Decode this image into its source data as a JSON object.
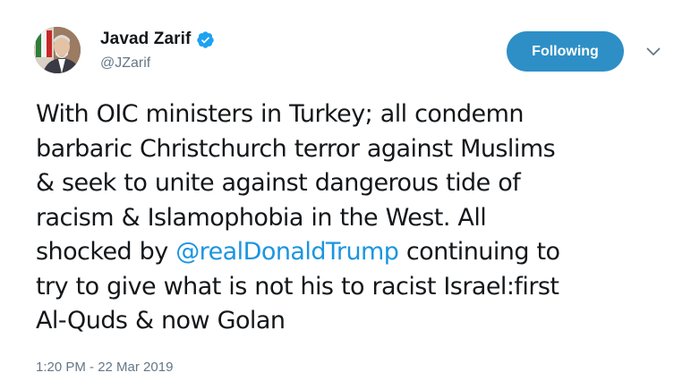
{
  "author": {
    "display_name": "Javad Zarif",
    "handle": "@JZarif",
    "verified": true
  },
  "follow_button": {
    "label": "Following"
  },
  "tweet": {
    "lines": [
      {
        "text": "With OIC ministers in Turkey; all condemn"
      },
      {
        "text": "barbaric Christchurch terror against Muslims"
      },
      {
        "text": "& seek to unite against dangerous tide of"
      },
      {
        "text": "racism & Islamophobia in the West. All"
      },
      {
        "before": "shocked by ",
        "mention": "@realDonaldTrump",
        "after": " continuing to"
      },
      {
        "text": "try to give what is not his to racist Israel:first"
      },
      {
        "text": "Al-Quds & now Golan"
      }
    ],
    "timestamp": "1:20 PM - 22 Mar 2019"
  },
  "icons": {
    "verified": "verified-badge-icon",
    "caret": "chevron-down-icon"
  },
  "colors": {
    "follow_button_bg": "#2d8fc6",
    "mention": "#1b95e0",
    "verified_badge": "#1da1f2",
    "secondary_text": "#657786"
  }
}
